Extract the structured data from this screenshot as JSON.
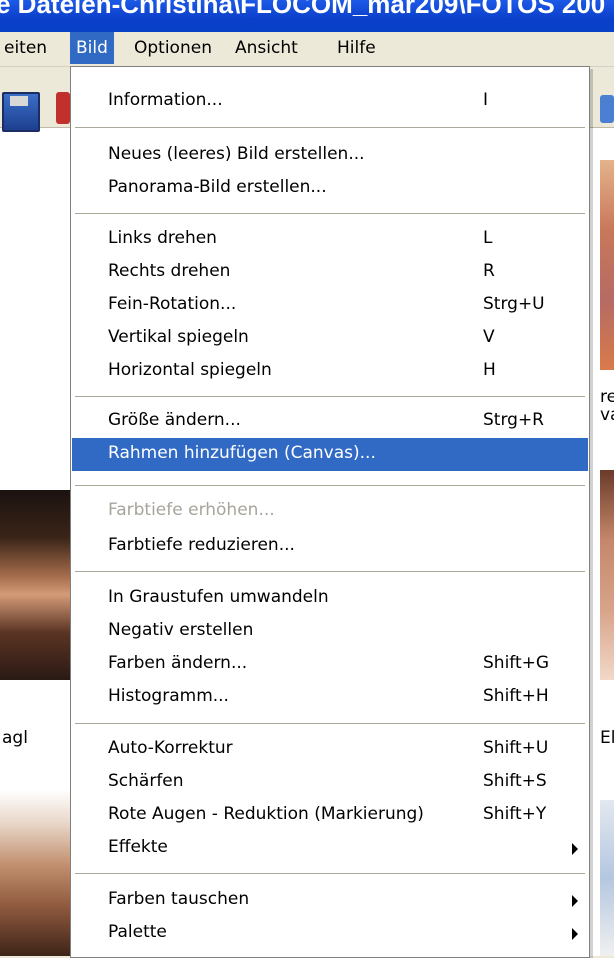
{
  "window": {
    "title": "e Dateien-Christina\\FLOCOM_mar209\\FOTOS 200"
  },
  "menubar": {
    "items": [
      {
        "label": "eiten",
        "active": false
      },
      {
        "label": "Bild",
        "active": true
      },
      {
        "label": "Optionen",
        "active": false
      },
      {
        "label": "Ansicht",
        "active": false
      },
      {
        "label": "Hilfe",
        "active": false
      }
    ]
  },
  "background": {
    "left_caption": "agl",
    "right_caption_1": "re\nva",
    "right_caption_2": "El"
  },
  "menu": {
    "items": [
      {
        "label": "Information...",
        "shortcut": "I"
      },
      {
        "label": "Neues (leeres) Bild erstellen...",
        "shortcut": ""
      },
      {
        "label": "Panorama-Bild erstellen...",
        "shortcut": ""
      },
      {
        "label": "Links drehen",
        "shortcut": "L"
      },
      {
        "label": "Rechts drehen",
        "shortcut": "R"
      },
      {
        "label": "Fein-Rotation...",
        "shortcut": "Strg+U"
      },
      {
        "label": "Vertikal spiegeln",
        "shortcut": "V"
      },
      {
        "label": "Horizontal spiegeln",
        "shortcut": "H"
      },
      {
        "label": "Größe ändern...",
        "shortcut": "Strg+R"
      },
      {
        "label": "Rahmen hinzufügen (Canvas)...",
        "shortcut": "",
        "highlighted": true
      },
      {
        "label": "Farbtiefe erhöhen...",
        "shortcut": "",
        "disabled": true
      },
      {
        "label": "Farbtiefe reduzieren...",
        "shortcut": ""
      },
      {
        "label": "In Graustufen umwandeln",
        "shortcut": ""
      },
      {
        "label": "Negativ erstellen",
        "shortcut": ""
      },
      {
        "label": "Farben ändern...",
        "shortcut": "Shift+G"
      },
      {
        "label": "Histogramm...",
        "shortcut": "Shift+H"
      },
      {
        "label": "Auto-Korrektur",
        "shortcut": "Shift+U"
      },
      {
        "label": "Schärfen",
        "shortcut": "Shift+S"
      },
      {
        "label": "Rote Augen - Reduktion (Markierung)",
        "shortcut": "Shift+Y"
      },
      {
        "label": "Effekte",
        "shortcut": "",
        "submenu": true
      },
      {
        "label": "Farben tauschen",
        "shortcut": "",
        "submenu": true
      },
      {
        "label": "Palette",
        "shortcut": "",
        "submenu": true
      }
    ]
  },
  "colors": {
    "highlight": "#316ac5",
    "titlebar": "#0a3fc9",
    "disabled": "#a7a49b"
  }
}
